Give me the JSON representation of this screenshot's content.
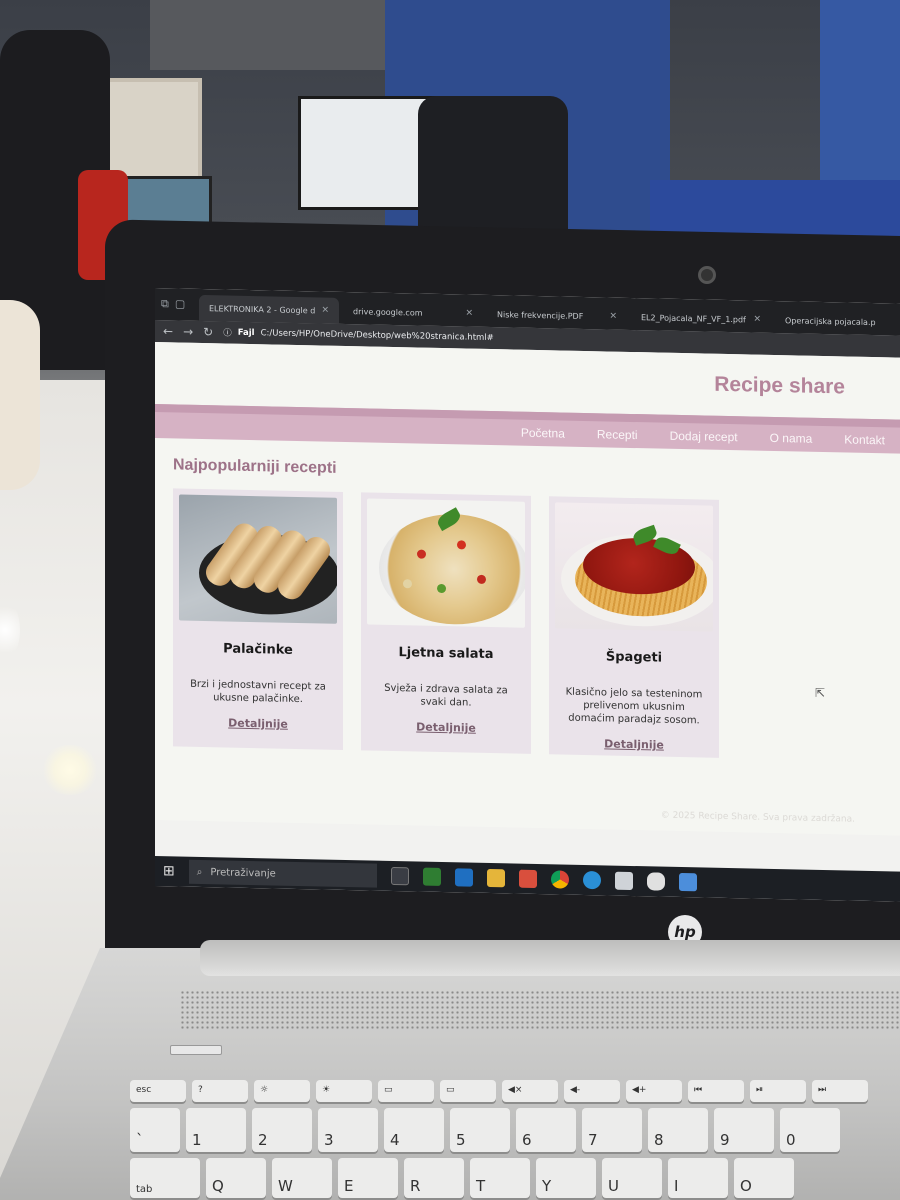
{
  "browser": {
    "tabs": [
      {
        "label": "ELEKTRONIKA 2 - Google d",
        "active": true
      },
      {
        "label": "drive.google.com",
        "active": false
      },
      {
        "label": "Niske frekvencije.PDF",
        "active": false
      },
      {
        "label": "EL2_Pojacala_NF_VF_1.pdf",
        "active": false
      },
      {
        "label": "Operacijska pojacala.p",
        "active": false
      }
    ],
    "address": {
      "scheme_label": "Fajl",
      "url": "C:/Users/HP/OneDrive/Desktop/web%20stranica.html#"
    }
  },
  "site": {
    "title": "Recipe share",
    "nav": [
      "Početna",
      "Recepti",
      "Dodaj recept",
      "O nama",
      "Kontakt"
    ],
    "section_title": "Najpopularniji recepti",
    "cards": [
      {
        "title": "Palačinke",
        "description": "Brzi i jednostavni recept za ukusne palačinke.",
        "link": "Detaljnije"
      },
      {
        "title": "Ljetna salata",
        "description": "Svježa i zdrava salata za svaki dan.",
        "link": "Detaljnije"
      },
      {
        "title": "Špageti",
        "description": "Klasično jelo sa testeninom prelivenom ukusnim domaćim paradajz sosom.",
        "link": "Detaljnije"
      }
    ],
    "footer": "© 2025 Recipe Share. Sva prava zadržana."
  },
  "taskbar": {
    "search_placeholder": "Pretraživanje"
  },
  "laptop": {
    "brand": "hp"
  },
  "colors": {
    "accent": "#d6b2c4",
    "title": "#b4849a",
    "card_bg": "#eae3ea"
  }
}
